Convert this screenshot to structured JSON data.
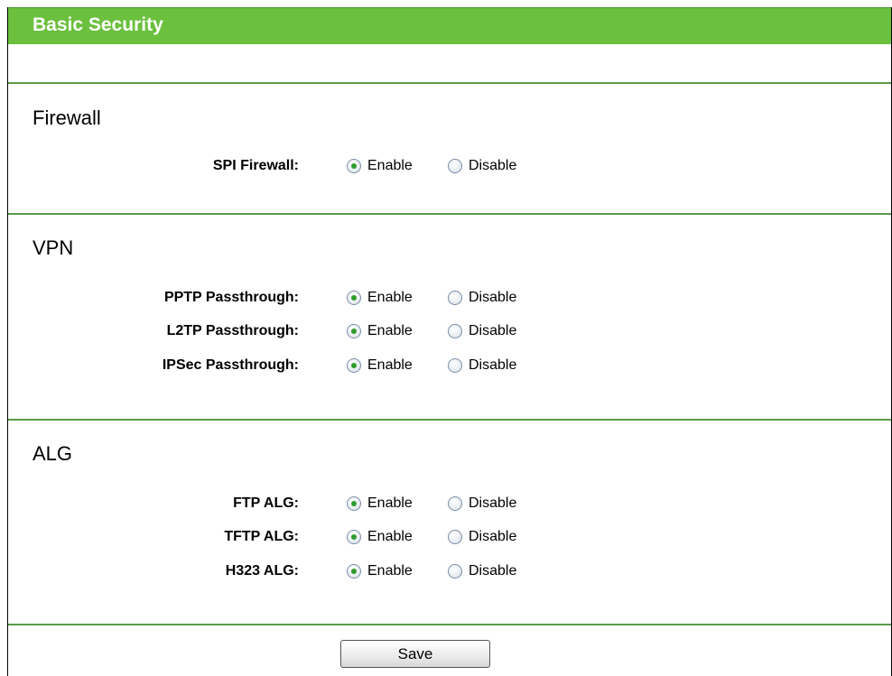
{
  "page": {
    "title": "Basic Security"
  },
  "sections": {
    "firewall": {
      "title": "Firewall",
      "rows": [
        {
          "label": "SPI Firewall:",
          "selected": "Enable"
        }
      ]
    },
    "vpn": {
      "title": "VPN",
      "rows": [
        {
          "label": "PPTP Passthrough:",
          "selected": "Enable"
        },
        {
          "label": "L2TP Passthrough:",
          "selected": "Enable"
        },
        {
          "label": "IPSec Passthrough:",
          "selected": "Enable"
        }
      ]
    },
    "alg": {
      "title": "ALG",
      "rows": [
        {
          "label": "FTP ALG:",
          "selected": "Enable"
        },
        {
          "label": "TFTP ALG:",
          "selected": "Enable"
        },
        {
          "label": "H323 ALG:",
          "selected": "Enable"
        }
      ]
    }
  },
  "options": {
    "enable": "Enable",
    "disable": "Disable"
  },
  "actions": {
    "save": "Save"
  },
  "colors": {
    "title_bar": "#6bc03e",
    "divider": "#5a9a4a",
    "radio_dot": "#2e9c2e"
  }
}
